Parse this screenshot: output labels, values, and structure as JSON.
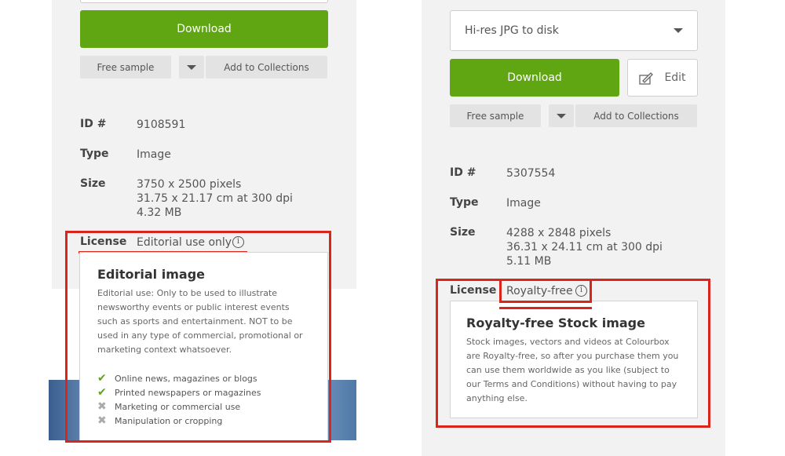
{
  "left": {
    "download_label": "Download",
    "free_sample_label": "Free sample",
    "add_to_collections_label": "Add to Collections",
    "details": {
      "id_label": "ID #",
      "id_value": "9108591",
      "type_label": "Type",
      "type_value": "Image",
      "size_label": "Size",
      "size_pixels": "3750 x 2500 pixels",
      "size_cm": "31.75 x 21.17 cm at 300 dpi",
      "size_mb": "4.32 MB",
      "license_label": "License",
      "license_value": "Editorial use only"
    },
    "popup": {
      "title": "Editorial image",
      "text": "Editorial use: Only to be used to illustrate newsworthy events or public interest events such as sports and entertainment. NOT to be used in any type of commercial, promotional or marketing context whatsoever.",
      "features": [
        {
          "label": "Online news, magazines or blogs",
          "allowed": true
        },
        {
          "label": "Printed newspapers or magazines",
          "allowed": true
        },
        {
          "label": "Marketing or commercial use",
          "allowed": false
        },
        {
          "label": "Manipulation or cropping",
          "allowed": false
        }
      ]
    }
  },
  "right": {
    "format_select": "Hi-res JPG to disk",
    "download_label": "Download",
    "edit_label": "Edit",
    "free_sample_label": "Free sample",
    "add_to_collections_label": "Add to Collections",
    "details": {
      "id_label": "ID #",
      "id_value": "5307554",
      "type_label": "Type",
      "type_value": "Image",
      "size_label": "Size",
      "size_pixels": "4288 x 2848 pixels",
      "size_cm": "36.31 x 24.11 cm at 300 dpi",
      "size_mb": "5.11 MB",
      "license_label": "License",
      "license_value": "Royalty-free"
    },
    "popup": {
      "title": "Royalty-free Stock image",
      "text": "Stock images, vectors and videos at Colourbox are Royalty-free, so after you purchase them you can use them worldwide as you like (subject to our Terms and Conditions) without having to pay anything else."
    }
  },
  "colors": {
    "accent_green": "#60a512",
    "highlight_red": "#d9261c"
  },
  "icons": {
    "info": "info-icon",
    "check": "check-icon",
    "cross": "cross-icon",
    "edit": "edit-icon",
    "dropdown": "chevron-down-icon"
  }
}
